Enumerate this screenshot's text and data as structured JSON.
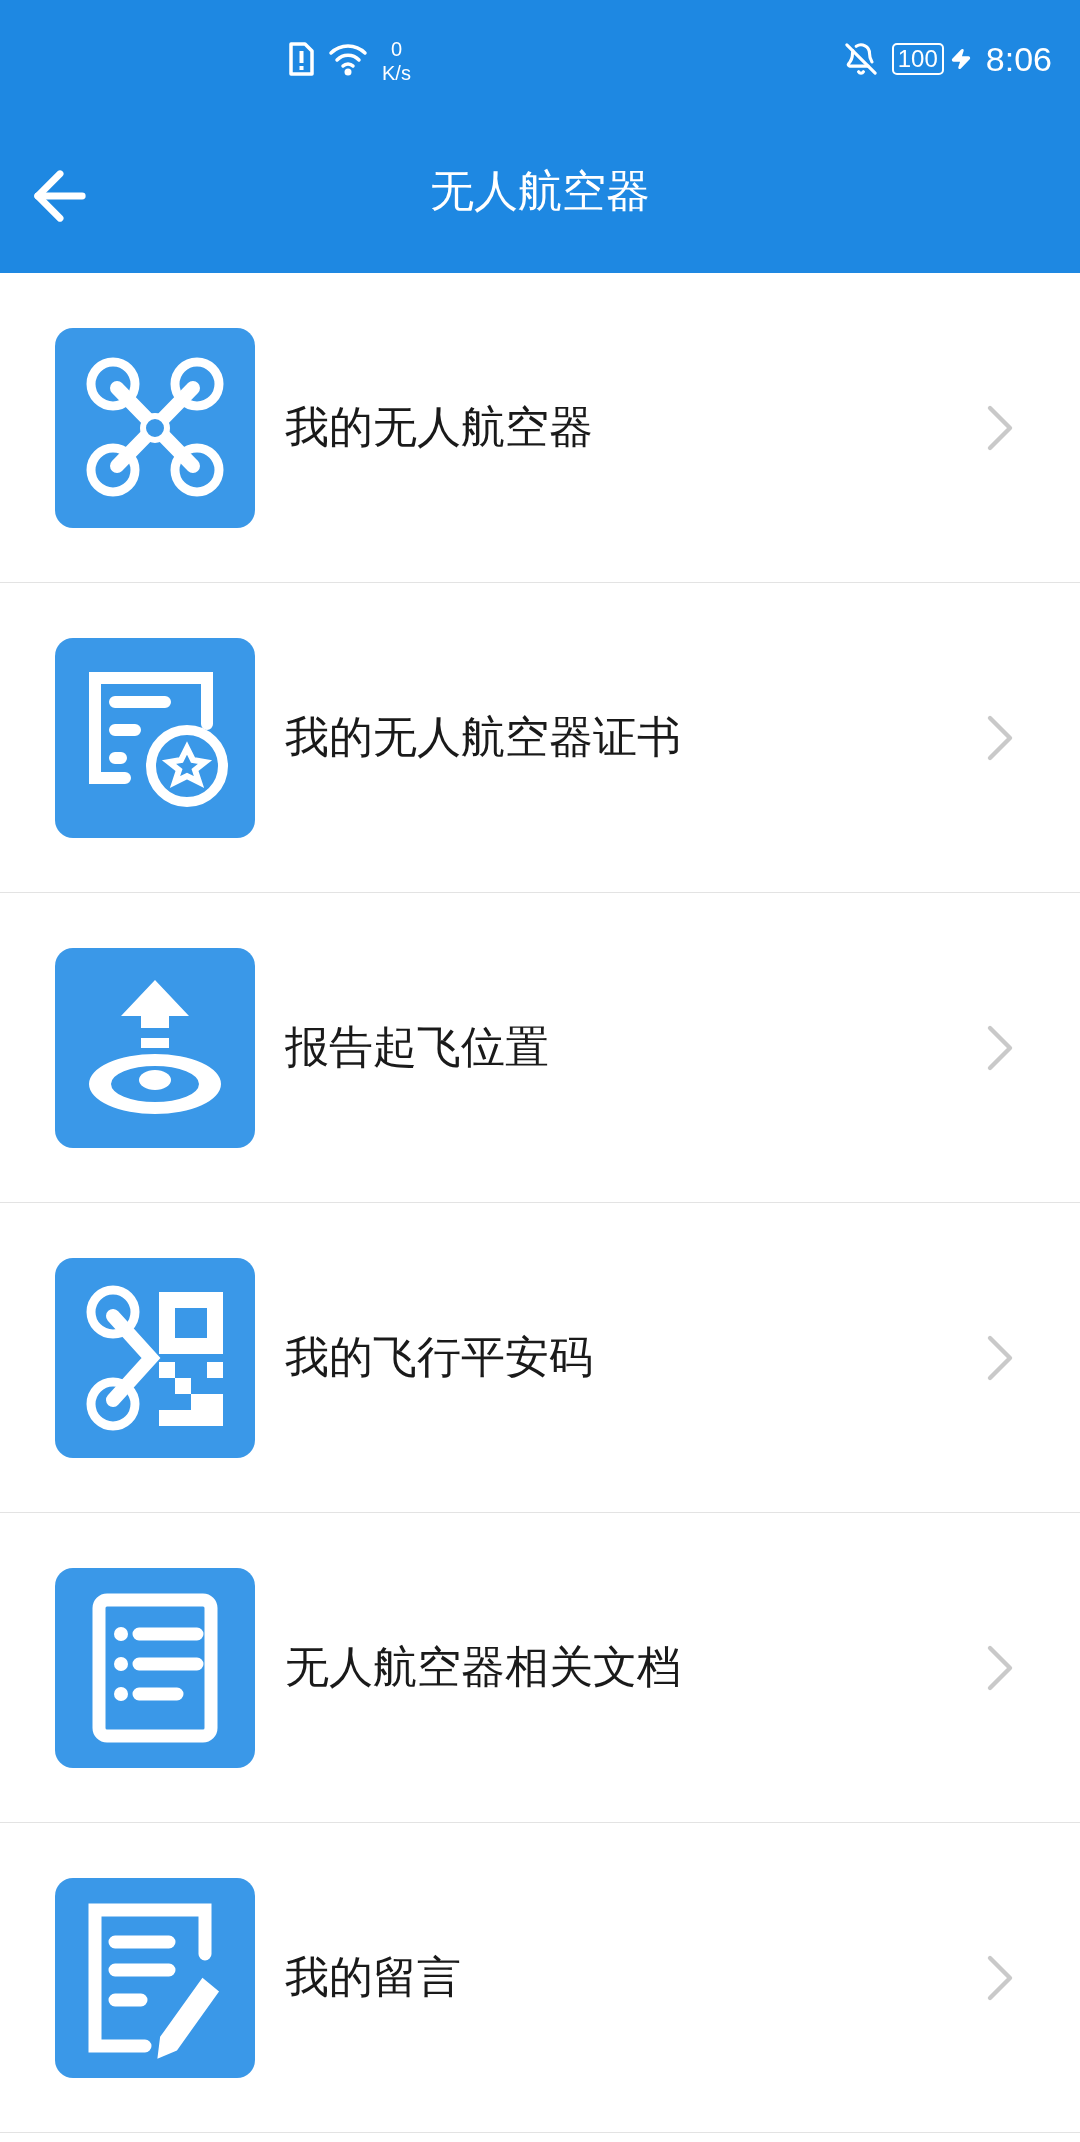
{
  "status_bar": {
    "speed_value": "0",
    "speed_unit": "K/s",
    "battery": "100",
    "time": "8:06"
  },
  "header": {
    "title": "无人航空器"
  },
  "items": [
    {
      "label": "我的无人航空器",
      "kind": "drone"
    },
    {
      "label": "我的无人航空器证书",
      "kind": "certificate"
    },
    {
      "label": "报告起飞位置",
      "kind": "takeoff"
    },
    {
      "label": "我的飞行平安码",
      "kind": "qrcode"
    },
    {
      "label": "无人航空器相关文档",
      "kind": "document"
    },
    {
      "label": "我的留言",
      "kind": "message"
    }
  ]
}
